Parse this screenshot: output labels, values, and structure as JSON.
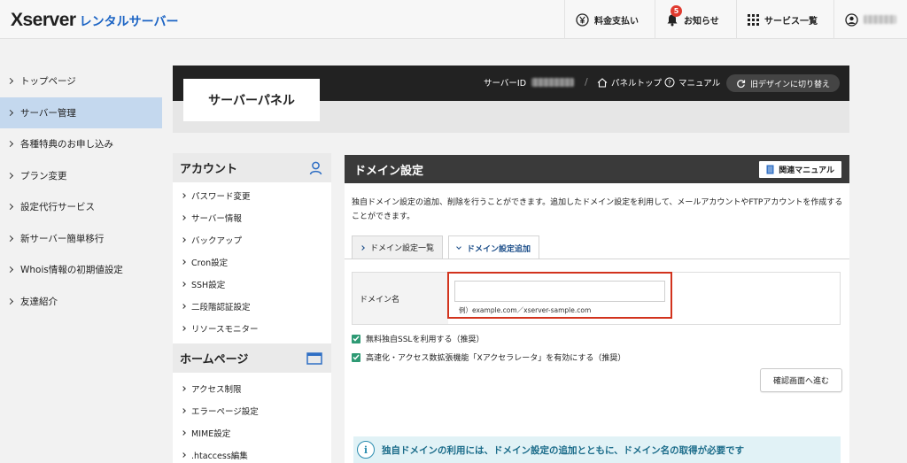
{
  "header": {
    "logo_text": "Xserver",
    "logo_sub": "レンタルサーバー",
    "nav": {
      "billing": "料金支払い",
      "notifications": "お知らせ",
      "notification_count": "5",
      "services": "サービス一覧"
    }
  },
  "sidebar": {
    "items": [
      {
        "label": "トップページ"
      },
      {
        "label": "サーバー管理"
      },
      {
        "label": "各種特典のお申し込み"
      },
      {
        "label": "プラン変更"
      },
      {
        "label": "設定代行サービス"
      },
      {
        "label": "新サーバー簡単移行"
      },
      {
        "label": "Whois情報の初期値設定"
      },
      {
        "label": "友達紹介"
      }
    ],
    "active_index": 1
  },
  "panel": {
    "title": "サーバーパネル",
    "server_id_label": "サーバーID",
    "panel_top": "パネルトップ",
    "manual": "マニュアル",
    "old_design": "旧デザインに切り替え"
  },
  "menu": {
    "account": {
      "title": "アカウント",
      "items": [
        "パスワード変更",
        "サーバー情報",
        "バックアップ",
        "Cron設定",
        "SSH設定",
        "二段階認証設定",
        "リソースモニター"
      ]
    },
    "homepage": {
      "title": "ホームページ",
      "items": [
        "アクセス制限",
        "エラーページ設定",
        "MIME設定",
        ".htaccess編集"
      ]
    }
  },
  "content": {
    "title": "ドメイン設定",
    "manual_button": "関連マニュアル",
    "description": "独自ドメイン設定の追加、削除を行うことができます。追加したドメイン設定を利用して、メールアカウントやFTPアカウントを作成することができます。",
    "tabs": [
      {
        "label": "ドメイン設定一覧"
      },
      {
        "label": "ドメイン設定追加"
      }
    ],
    "form": {
      "domain_label": "ドメイン名",
      "domain_value": "",
      "hint": "例）example.com／xserver-sample.com"
    },
    "options": {
      "ssl": "無料独自SSLを利用する（推奨）",
      "accelerator": "高速化・アクセス数拡張機能「Xアクセラレータ」を有効にする（推奨）"
    },
    "confirm_button": "確認画面へ進む",
    "notice": "独自ドメインの利用には、ドメイン設定の追加とともに、ドメイン名の取得が必要です"
  },
  "colors": {
    "brand_blue": "#1c64c4",
    "active_nav": "#c4d8ee",
    "highlight_red": "#d2331d",
    "check_green": "#2e9a74",
    "notice_bg": "#e1f2f6"
  }
}
